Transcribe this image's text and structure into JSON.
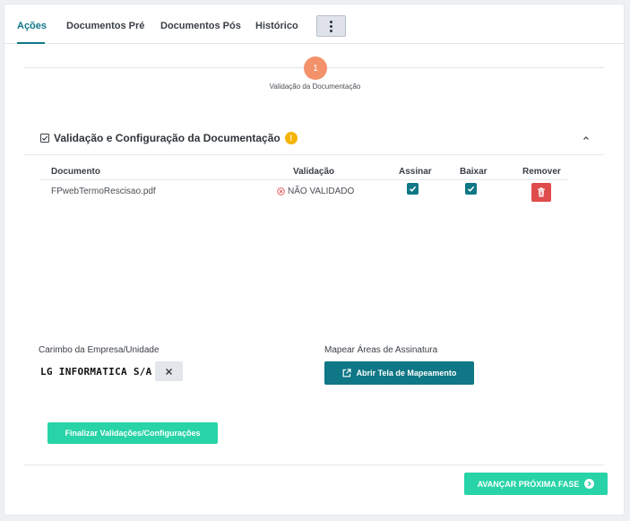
{
  "tabs": {
    "acoes": "Ações",
    "documentos_pre": "Documentos Pré",
    "documentos_pos": "Documentos Pós",
    "historico": "Histórico"
  },
  "stepper": {
    "step_number": "1",
    "step_label": "Validação da Documentação"
  },
  "section": {
    "title": "Validação e Configuração da Documentação",
    "warning_badge": "!"
  },
  "table": {
    "headers": {
      "documento": "Documento",
      "validacao": "Validação",
      "assinar": "Assinar",
      "baixar": "Baixar",
      "remover": "Remover"
    },
    "rows": [
      {
        "documento": "FPwebTermoRescisao.pdf",
        "validacao": "NÃO VALIDADO",
        "assinar": true,
        "baixar": true
      }
    ]
  },
  "stamp": {
    "label": "Carimbo da Empresa/Unidade",
    "value": "LG INFORMATICA S/A"
  },
  "mapping": {
    "label": "Mapear Áreas de Assinatura",
    "button": "Abrir Tela de Mapeamento"
  },
  "actions": {
    "finalize": "Finalizar Validações/Configurações",
    "advance": "AVANÇAR PRÓXIMA FASE"
  },
  "colors": {
    "accent": "#0f7786",
    "success": "#27d3a7",
    "step": "#f3916b",
    "warning": "#f4b400",
    "danger": "#e04b4b"
  },
  "icons": {
    "more": "kebab-vertical-icon",
    "section": "check-square-icon",
    "collapse": "chevron-up-icon",
    "status": "x-circle-icon",
    "checkbox": "check-icon",
    "remove": "trash-icon",
    "clear": "close-icon",
    "open": "external-link-icon",
    "advance": "chevron-right-circle-icon"
  }
}
